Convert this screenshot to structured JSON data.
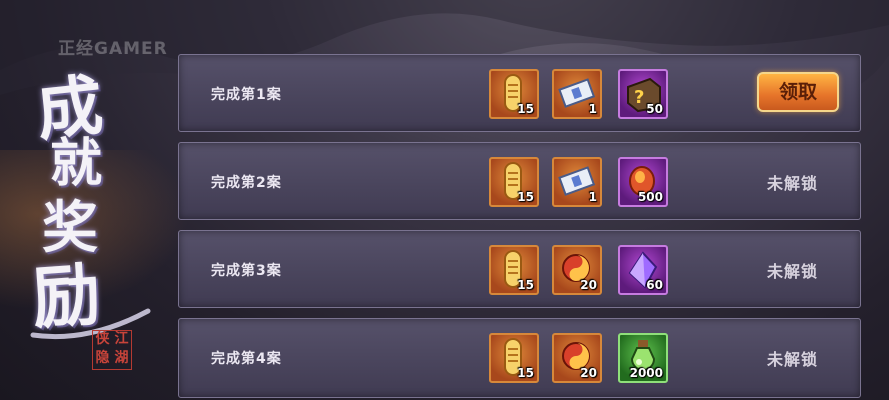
{
  "watermark": "正经GAMER",
  "title_chars": [
    "成",
    "就",
    "奖",
    "励"
  ],
  "seal_chars": [
    "侠",
    "江",
    "隐",
    "湖"
  ],
  "rows": [
    {
      "label": "完成第1案",
      "rewards": [
        {
          "icon": "token-coin-icon",
          "quantity": "15",
          "rarity": "orange"
        },
        {
          "icon": "letter-ticket-icon",
          "quantity": "1",
          "rarity": "orange"
        },
        {
          "icon": "mystery-box-icon",
          "quantity": "50",
          "rarity": "purple"
        }
      ],
      "status": "claim",
      "action_label": "领取"
    },
    {
      "label": "完成第2案",
      "rewards": [
        {
          "icon": "token-coin-icon",
          "quantity": "15",
          "rarity": "orange"
        },
        {
          "icon": "letter-ticket-icon",
          "quantity": "1",
          "rarity": "orange"
        },
        {
          "icon": "red-gem-icon",
          "quantity": "500",
          "rarity": "purple"
        }
      ],
      "status": "locked",
      "action_label": "未解锁"
    },
    {
      "label": "完成第3案",
      "rewards": [
        {
          "icon": "token-coin-icon",
          "quantity": "15",
          "rarity": "orange"
        },
        {
          "icon": "red-orb-icon",
          "quantity": "20",
          "rarity": "orange"
        },
        {
          "icon": "purple-crystal-icon",
          "quantity": "60",
          "rarity": "purple"
        }
      ],
      "status": "locked",
      "action_label": "未解锁"
    },
    {
      "label": "完成第4案",
      "rewards": [
        {
          "icon": "token-coin-icon",
          "quantity": "15",
          "rarity": "orange"
        },
        {
          "icon": "red-orb-icon",
          "quantity": "20",
          "rarity": "orange"
        },
        {
          "icon": "green-potion-icon",
          "quantity": "2000",
          "rarity": "green"
        }
      ],
      "status": "locked",
      "action_label": "未解锁"
    }
  ],
  "colors": {
    "panel": "#4a455c",
    "claim_button": "#f08a2e",
    "orange_frame": "#d7883a",
    "purple_frame": "#c67be0",
    "green_frame": "#8fe07a"
  }
}
